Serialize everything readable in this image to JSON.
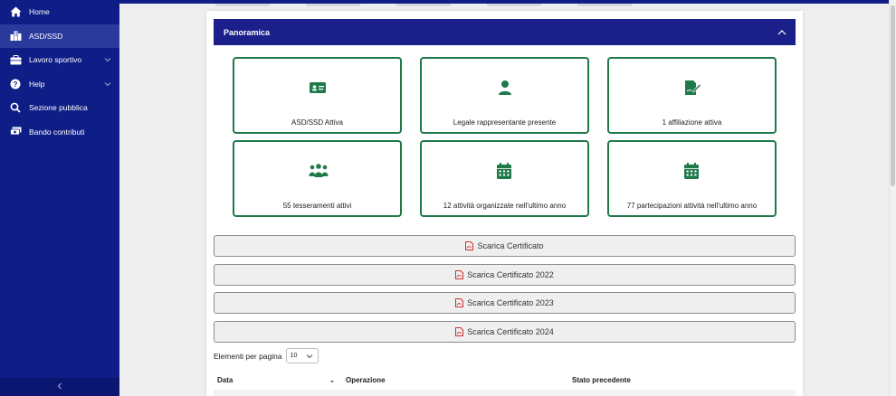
{
  "sidebar": {
    "items": [
      {
        "label": "Home",
        "icon": "home-icon"
      },
      {
        "label": "ASD/SSD",
        "icon": "building-icon",
        "active": true
      },
      {
        "label": "Lavoro sportivo",
        "icon": "briefcase-icon",
        "expandable": true
      },
      {
        "label": "Help",
        "icon": "question-icon",
        "expandable": true
      },
      {
        "label": "Sezione pubblica",
        "icon": "search-icon"
      },
      {
        "label": "Bando contributi",
        "icon": "money-icon"
      }
    ]
  },
  "panel": {
    "title": "Panoramica"
  },
  "tiles": [
    {
      "label": "ASD/SSD Attiva",
      "icon": "id-card-icon"
    },
    {
      "label": "Legale rappresentante presente",
      "icon": "user-icon"
    },
    {
      "label": "1 affiliazione attiva",
      "icon": "signature-icon"
    },
    {
      "label": "55 tesseramenti attivi",
      "icon": "people-icon"
    },
    {
      "label": "12 attività organizzate nell'ultimo anno",
      "icon": "calendar-icon"
    },
    {
      "label": "77 partecipazioni attività nell'ultimo anno",
      "icon": "calendar-icon"
    }
  ],
  "downloads": [
    {
      "label": "Scarica Certificato"
    },
    {
      "label": "Scarica Certificato 2022"
    },
    {
      "label": "Scarica Certificato 2023"
    },
    {
      "label": "Scarica Certificato 2024"
    }
  ],
  "pagination": {
    "label": "Elementi per pagina",
    "value": "10"
  },
  "table": {
    "headers": [
      "Data",
      "Operazione",
      "Stato precedente"
    ]
  },
  "colors": {
    "sidebar": "#0f1e87",
    "panel_header": "#1a1f8a",
    "tile_border": "#1f7a4a",
    "pdf_icon": "#d32f2f"
  }
}
